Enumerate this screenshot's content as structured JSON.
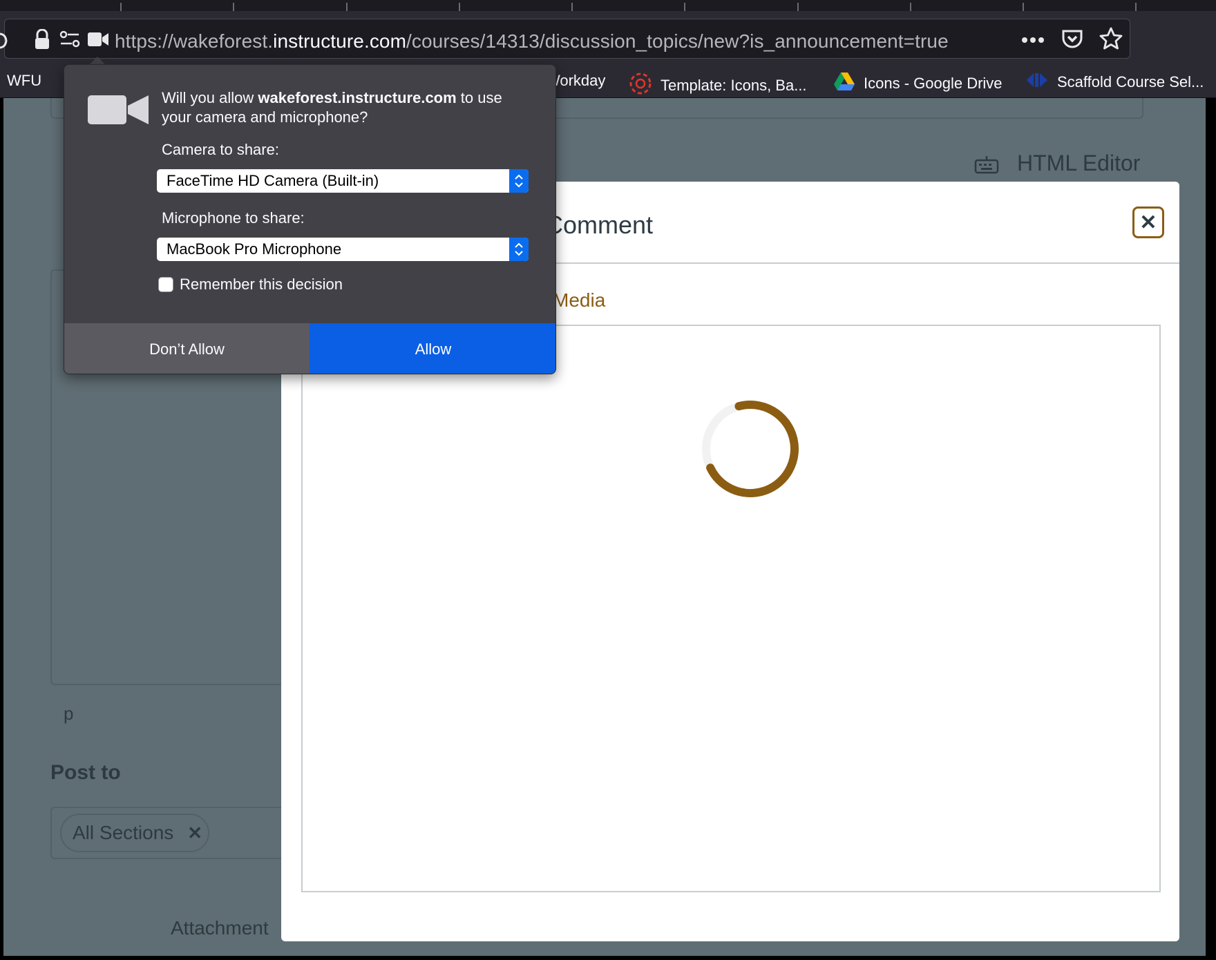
{
  "browser": {
    "url": {
      "prefix": "https://wakeforest.",
      "host": "instructure.com",
      "path": "/courses/14313/discussion_topics/new?is_announcement=true"
    },
    "bookmarks": [
      {
        "label": "WFU"
      },
      {
        "label": "Workday"
      },
      {
        "label": "Template: Icons, Ba..."
      },
      {
        "label": "Icons - Google Drive"
      },
      {
        "label": "Scaffold Course Sel..."
      }
    ]
  },
  "page": {
    "html_editor": "HTML Editor",
    "path_indicator": "p",
    "post_to": "Post to",
    "section_chip": "All Sections",
    "attachment": "Attachment"
  },
  "modal": {
    "title": "Comment",
    "tab": "Media"
  },
  "permission": {
    "message_before": "Will you allow ",
    "message_host": "wakeforest.instructure.com",
    "message_after": " to use your camera and microphone?",
    "camera_label": "Camera to share:",
    "camera_value": "FaceTime HD Camera (Built-in)",
    "microphone_label": "Microphone to share:",
    "microphone_value": "MacBook Pro Microphone",
    "remember_label": "Remember this decision",
    "deny_label": "Don’t Allow",
    "allow_label": "Allow"
  },
  "colors": {
    "accent": "#8b5d13",
    "allow_blue": "#0a5fe5"
  }
}
